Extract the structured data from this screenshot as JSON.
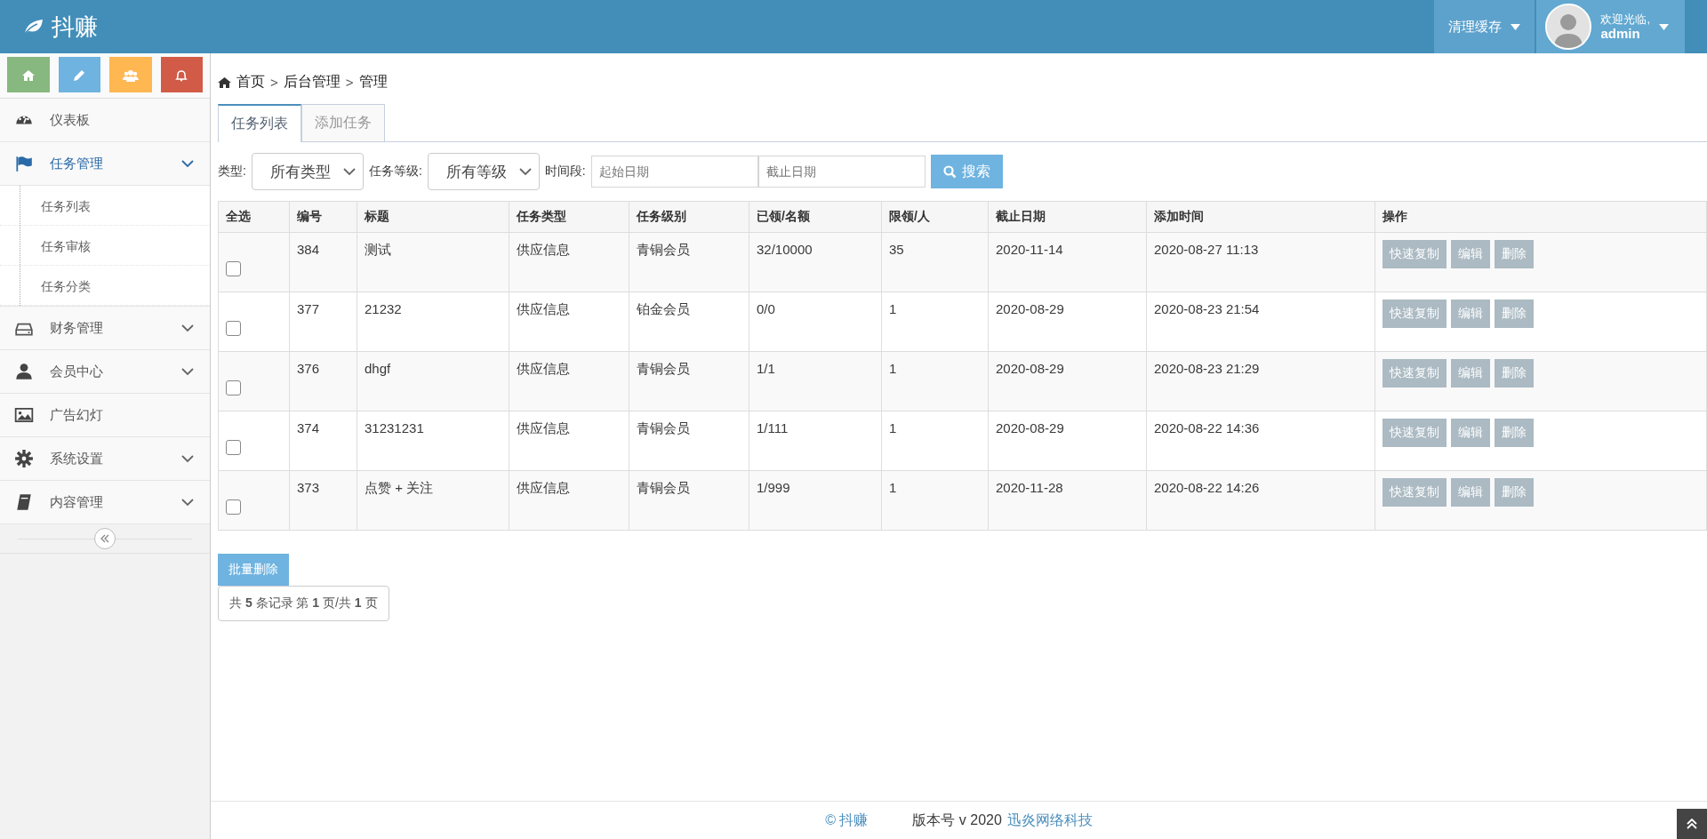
{
  "navbar": {
    "brand": "抖赚",
    "clear_cache": "清理缓存",
    "welcome": "欢迎光临,",
    "user": "admin"
  },
  "sidebar": {
    "items": [
      {
        "label": "仪表板",
        "kind": "link",
        "expanded": false
      },
      {
        "label": "任务管理",
        "kind": "group",
        "expanded": true,
        "children": [
          {
            "label": "任务列表"
          },
          {
            "label": "任务审核"
          },
          {
            "label": "任务分类"
          }
        ]
      },
      {
        "label": "财务管理",
        "kind": "group",
        "expanded": false
      },
      {
        "label": "会员中心",
        "kind": "group",
        "expanded": false
      },
      {
        "label": "广告幻灯",
        "kind": "link",
        "expanded": false
      },
      {
        "label": "系统设置",
        "kind": "group",
        "expanded": false
      },
      {
        "label": "内容管理",
        "kind": "group",
        "expanded": false
      }
    ]
  },
  "breadcrumb": [
    {
      "kind": "link",
      "text": "首页"
    },
    {
      "kind": "separator",
      "text": ">"
    },
    {
      "kind": "link",
      "text": "后台管理"
    },
    {
      "kind": "separator",
      "text": ">"
    },
    {
      "kind": "link",
      "text": "管理"
    }
  ],
  "tabs": [
    {
      "label": "任务列表",
      "selected": true
    },
    {
      "label": "添加任务",
      "selected": false
    }
  ],
  "filters": {
    "type_label": "类型:",
    "type_value": "所有类型",
    "level_label": "任务等级:",
    "level_value": "所有等级",
    "period_label": "时间段:",
    "start_placeholder": "起始日期",
    "end_placeholder": "截止日期",
    "search": "搜索"
  },
  "table": {
    "columns": [
      "全选",
      "编号",
      "标题",
      "任务类型",
      "任务级别",
      "已领/名额",
      "限领/人",
      "截止日期",
      "添加时间",
      "操作"
    ],
    "rows": [
      {
        "cells": [
          {
            "kind": "checkbox",
            "checked": false
          },
          {
            "kind": "text",
            "text": "384"
          },
          {
            "kind": "text",
            "text": "测试"
          },
          {
            "kind": "text",
            "text": "供应信息"
          },
          {
            "kind": "text",
            "text": "青铜会员"
          },
          {
            "kind": "text",
            "text": "32/10000"
          },
          {
            "kind": "text",
            "text": "35"
          },
          {
            "kind": "text",
            "text": "2020-11-14"
          },
          {
            "kind": "text",
            "text": "2020-08-27 11:13"
          },
          {
            "kind": "actions",
            "actions": [
              "快速复制",
              "编辑",
              "删除"
            ]
          }
        ]
      },
      {
        "cells": [
          {
            "kind": "checkbox",
            "checked": false
          },
          {
            "kind": "text",
            "text": "377"
          },
          {
            "kind": "text",
            "text": "21232"
          },
          {
            "kind": "text",
            "text": "供应信息"
          },
          {
            "kind": "text",
            "text": "铂金会员"
          },
          {
            "kind": "text",
            "text": "0/0"
          },
          {
            "kind": "text",
            "text": "1"
          },
          {
            "kind": "text",
            "text": "2020-08-29"
          },
          {
            "kind": "text",
            "text": "2020-08-23 21:54"
          },
          {
            "kind": "actions",
            "actions": [
              "快速复制",
              "编辑",
              "删除"
            ]
          }
        ]
      },
      {
        "cells": [
          {
            "kind": "checkbox",
            "checked": false
          },
          {
            "kind": "text",
            "text": "376"
          },
          {
            "kind": "text",
            "text": "dhgf"
          },
          {
            "kind": "text",
            "text": "供应信息"
          },
          {
            "kind": "text",
            "text": "青铜会员"
          },
          {
            "kind": "text",
            "text": "1/1"
          },
          {
            "kind": "text",
            "text": "1"
          },
          {
            "kind": "text",
            "text": "2020-08-29"
          },
          {
            "kind": "text",
            "text": "2020-08-23 21:29"
          },
          {
            "kind": "actions",
            "actions": [
              "快速复制",
              "编辑",
              "删除"
            ]
          }
        ]
      },
      {
        "cells": [
          {
            "kind": "checkbox",
            "checked": false
          },
          {
            "kind": "text",
            "text": "374"
          },
          {
            "kind": "text",
            "text": "31231231"
          },
          {
            "kind": "text",
            "text": "供应信息"
          },
          {
            "kind": "text",
            "text": "青铜会员"
          },
          {
            "kind": "text",
            "text": "1/111"
          },
          {
            "kind": "text",
            "text": "1"
          },
          {
            "kind": "text",
            "text": "2020-08-29"
          },
          {
            "kind": "text",
            "text": "2020-08-22 14:36"
          },
          {
            "kind": "actions",
            "actions": [
              "快速复制",
              "编辑",
              "删除"
            ]
          }
        ]
      },
      {
        "cells": [
          {
            "kind": "checkbox",
            "checked": false
          },
          {
            "kind": "text",
            "text": "373"
          },
          {
            "kind": "text",
            "text": "点赞 + 关注"
          },
          {
            "kind": "text",
            "text": "供应信息"
          },
          {
            "kind": "text",
            "text": "青铜会员"
          },
          {
            "kind": "text",
            "text": "1/999"
          },
          {
            "kind": "text",
            "text": "1"
          },
          {
            "kind": "text",
            "text": "2020-11-28"
          },
          {
            "kind": "text",
            "text": "2020-08-22 14:26"
          },
          {
            "kind": "actions",
            "actions": [
              "快速复制",
              "编辑",
              "删除"
            ]
          }
        ]
      }
    ]
  },
  "batch_delete": "批量删除",
  "pager": "共 **5** 条记录 第 **1** 页/共 **1** 页",
  "footer": {
    "brand": "© 抖赚",
    "version": "版本号 v 2020",
    "company": "迅炎网络科技"
  }
}
